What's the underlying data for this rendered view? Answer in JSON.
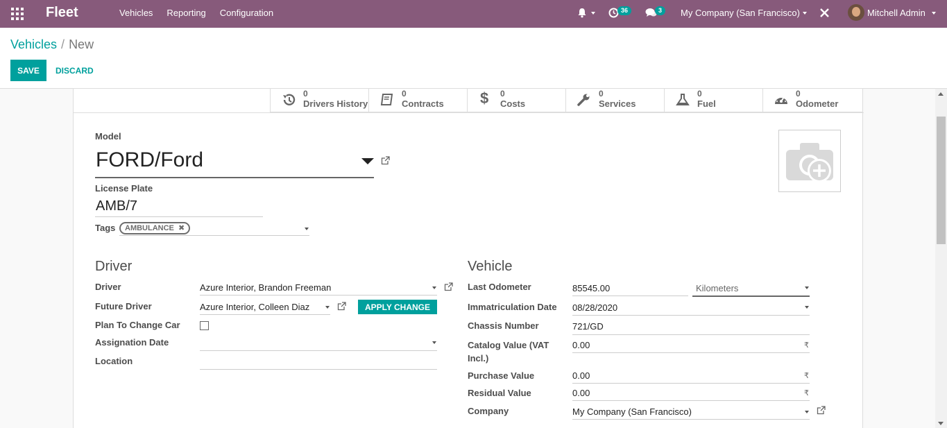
{
  "colors": {
    "navbar": "#875a7b",
    "accent": "#00a09d"
  },
  "navbar": {
    "app_name": "Fleet",
    "menu": [
      "Vehicles",
      "Reporting",
      "Configuration"
    ],
    "activity_count": "36",
    "message_count": "3",
    "company": "My Company (San Francisco)",
    "user": "Mitchell Admin"
  },
  "breadcrumb": {
    "parent": "Vehicles",
    "current": "New"
  },
  "actions": {
    "save": "SAVE",
    "discard": "DISCARD"
  },
  "smart_buttons": [
    {
      "icon": "history-icon",
      "value": "0",
      "label": "Drivers History"
    },
    {
      "icon": "book-icon",
      "value": "0",
      "label": "Contracts"
    },
    {
      "icon": "dollar-icon",
      "value": "0",
      "label": "Costs"
    },
    {
      "icon": "wrench-icon",
      "value": "0",
      "label": "Services"
    },
    {
      "icon": "flask-icon",
      "value": "0",
      "label": "Fuel"
    },
    {
      "icon": "tachometer-icon",
      "value": "0",
      "label": "Odometer"
    }
  ],
  "form": {
    "model_label": "Model",
    "model_value": "FORD/Ford",
    "plate_label": "License Plate",
    "plate_value": "AMB/7",
    "tags_label": "Tags",
    "tags": [
      "AMBULANCE"
    ]
  },
  "driver_section": {
    "title": "Driver",
    "driver_label": "Driver",
    "driver_value": "Azure Interior, Brandon Freeman",
    "future_driver_label": "Future Driver",
    "future_driver_value": "Azure Interior, Colleen Diaz",
    "apply_change": "APPLY CHANGE",
    "plan_change_label": "Plan To Change Car",
    "plan_change_checked": false,
    "assignation_label": "Assignation Date",
    "assignation_value": "",
    "location_label": "Location",
    "location_value": ""
  },
  "vehicle_section": {
    "title": "Vehicle",
    "odometer_label": "Last Odometer",
    "odometer_value": "85545.00",
    "odometer_unit": "Kilometers",
    "immat_label": "Immatriculation Date",
    "immat_value": "08/28/2020",
    "chassis_label": "Chassis Number",
    "chassis_value": "721/GD",
    "catalog_label_1": "Catalog Value (VAT",
    "catalog_label_2": "Incl.)",
    "catalog_value": "0.00",
    "purchase_label": "Purchase Value",
    "purchase_value": "0.00",
    "residual_label": "Residual Value",
    "residual_value": "0.00",
    "company_label": "Company",
    "company_value": "My Company (San Francisco)",
    "currency": "₹"
  }
}
